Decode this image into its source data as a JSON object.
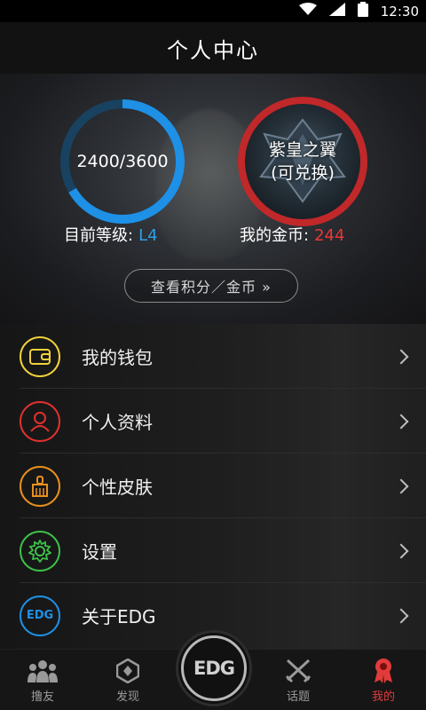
{
  "status_bar": {
    "time": "12:30",
    "icons": [
      "wifi-icon",
      "signal-icon",
      "battery-icon"
    ]
  },
  "header": {
    "title": "个人中心"
  },
  "profile": {
    "progress": {
      "current": 2400,
      "total": 3600,
      "text": "2400/3600",
      "color": "#1e90e6"
    },
    "badge": {
      "line1": "紫皇之翼",
      "line2": "(可兑换)",
      "ring_color": "#c0282a"
    },
    "level": {
      "label": "目前等级:",
      "value": "L4",
      "color": "#2aa1e8"
    },
    "coins": {
      "label": "我的金币:",
      "value": "244",
      "color": "#e8383a"
    },
    "view_button": "查看积分／金币 »"
  },
  "menu": {
    "items": [
      {
        "label": "我的钱包",
        "icon": "wallet-icon",
        "color": "#f0d23c"
      },
      {
        "label": "个人资料",
        "icon": "user-icon",
        "color": "#e0312f"
      },
      {
        "label": "个性皮肤",
        "icon": "brush-icon",
        "color": "#e8901f"
      },
      {
        "label": "设置",
        "icon": "gear-icon",
        "color": "#3ec04a"
      },
      {
        "label": "关于EDG",
        "icon": "edg-logo-icon",
        "color": "#1e90e6",
        "icon_text": "EDG"
      }
    ]
  },
  "tabbar": {
    "tabs": [
      {
        "label": "撸友",
        "icon": "friends-icon"
      },
      {
        "label": "发现",
        "icon": "discover-icon"
      },
      {
        "label": "话题",
        "icon": "swords-icon"
      },
      {
        "label": "我的",
        "icon": "medal-icon",
        "active": true
      }
    ],
    "center_logo": "EDG"
  }
}
